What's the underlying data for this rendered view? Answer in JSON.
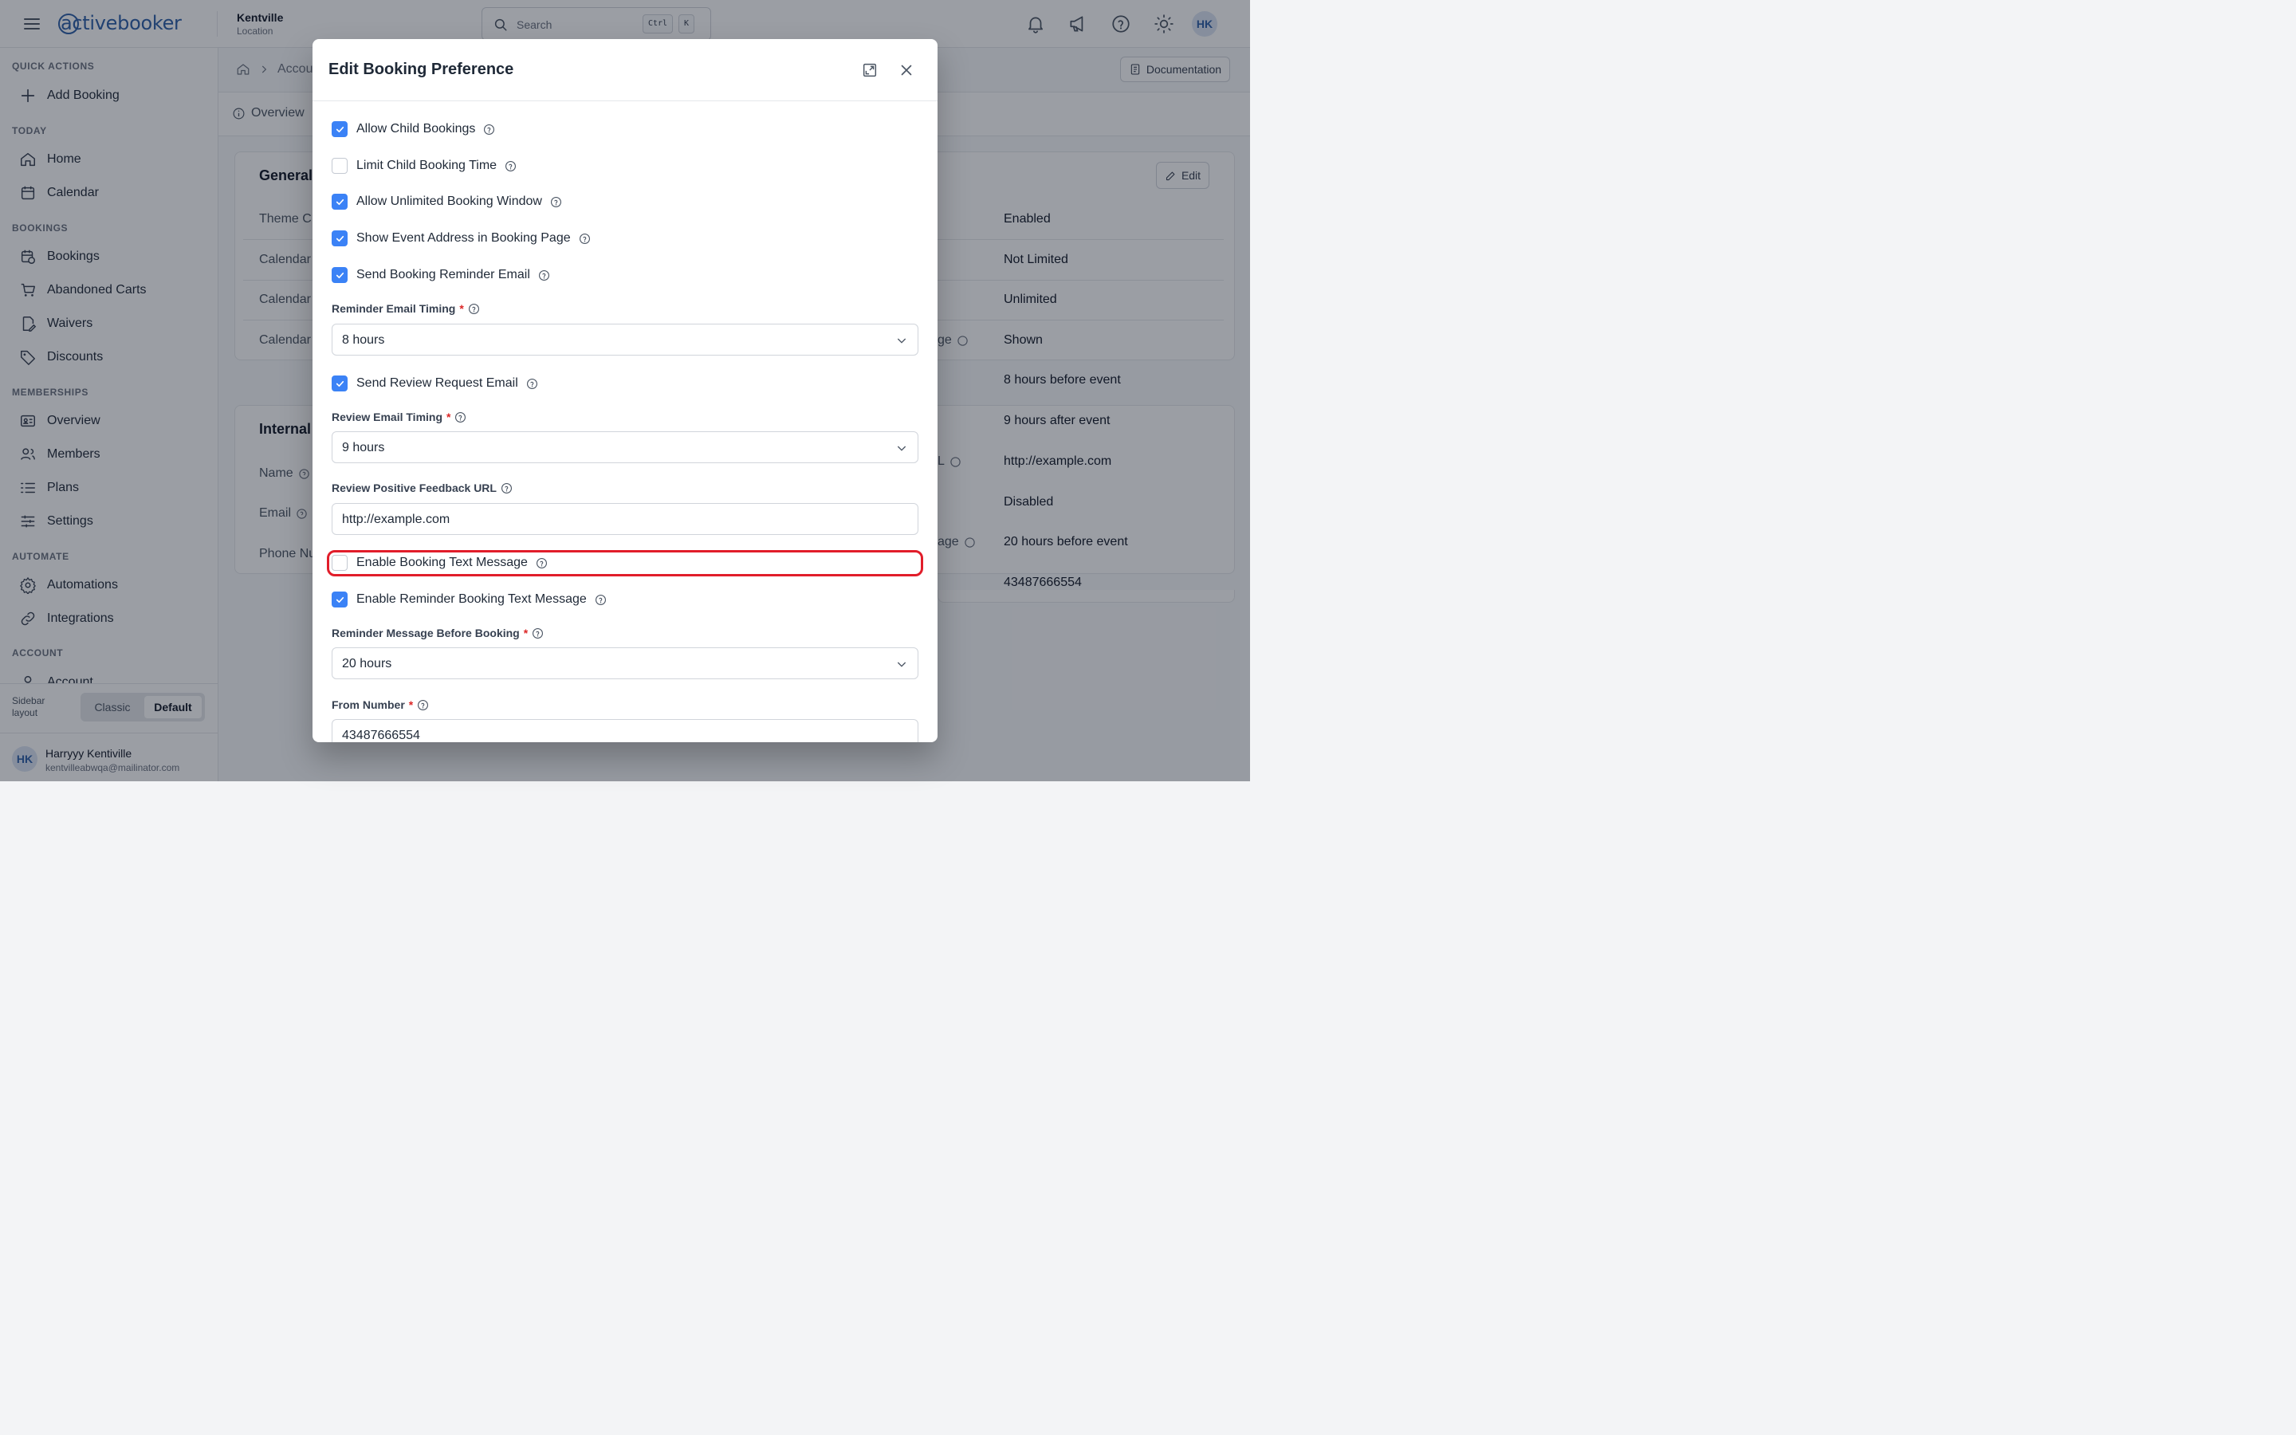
{
  "app": {
    "brand": "activebooker",
    "brand_color": "#2d5fa8"
  },
  "topbar": {
    "location_name": "Kentville",
    "location_sub": "Location",
    "search_placeholder": "Search",
    "kbd_ctrl": "Ctrl",
    "kbd_k": "K",
    "avatar": "HK"
  },
  "sidebar": {
    "sections": {
      "quick": "QUICK ACTIONS",
      "today": "TODAY",
      "bookings": "BOOKINGS",
      "memberships": "MEMBERSHIPS",
      "automate": "AUTOMATE",
      "account": "ACCOUNT"
    },
    "items": {
      "add_booking": "Add Booking",
      "home": "Home",
      "calendar": "Calendar",
      "bookings": "Bookings",
      "abandoned_carts": "Abandoned Carts",
      "waivers": "Waivers",
      "discounts": "Discounts",
      "overview": "Overview",
      "members": "Members",
      "plans": "Plans",
      "settings": "Settings",
      "automations": "Automations",
      "integrations": "Integrations",
      "account": "Account"
    },
    "layout_label": "Sidebar layout",
    "layout_classic": "Classic",
    "layout_default": "Default",
    "user_initials": "HK",
    "user_name": "Harryyy Kentiville",
    "user_email": "kentvilleabwqa@mailinator.com"
  },
  "main": {
    "breadcrumb": "Accou",
    "documentation": "Documentation",
    "tab_overview": "Overview",
    "card1_title": "General",
    "card2_title": "Internal",
    "edit": "Edit",
    "labels": {
      "theme": "Theme C",
      "cal1": "Calendar",
      "cal2": "Calendar",
      "cal3": "Calendar",
      "name": "Name",
      "email": "Email",
      "phone": "Phone Nu",
      "right_ge": "ge",
      "right_l": "L",
      "right_age": "age"
    },
    "values": [
      "Enabled",
      "Not Limited",
      "Unlimited",
      "Shown",
      "8 hours before event",
      "9 hours after event",
      "http://example.com",
      "Disabled",
      "20 hours before event",
      "43487666554"
    ]
  },
  "modal": {
    "title": "Edit Booking Preference",
    "checkboxes": {
      "allow_child": {
        "label": "Allow Child Bookings",
        "checked": true
      },
      "limit_child": {
        "label": "Limit Child Booking Time",
        "checked": false
      },
      "unlimited_window": {
        "label": "Allow Unlimited Booking Window",
        "checked": true
      },
      "show_address": {
        "label": "Show Event Address in Booking Page",
        "checked": true
      },
      "send_reminder": {
        "label": "Send Booking Reminder Email",
        "checked": true
      },
      "send_review": {
        "label": "Send Review Request Email",
        "checked": true
      },
      "enable_text": {
        "label": "Enable Booking Text Message",
        "checked": false
      },
      "enable_reminder_text": {
        "label": "Enable Reminder Booking Text Message",
        "checked": true
      }
    },
    "fields": {
      "reminder_timing": {
        "label": "Reminder Email Timing",
        "value": "8 hours"
      },
      "review_timing": {
        "label": "Review Email Timing",
        "value": "9 hours"
      },
      "review_url": {
        "label": "Review Positive Feedback URL",
        "value": "http://example.com"
      },
      "reminder_message": {
        "label": "Reminder Message Before Booking",
        "value": "20 hours"
      },
      "from_number": {
        "label": "From Number",
        "value": "43487666554"
      }
    },
    "required_mark": "*"
  }
}
